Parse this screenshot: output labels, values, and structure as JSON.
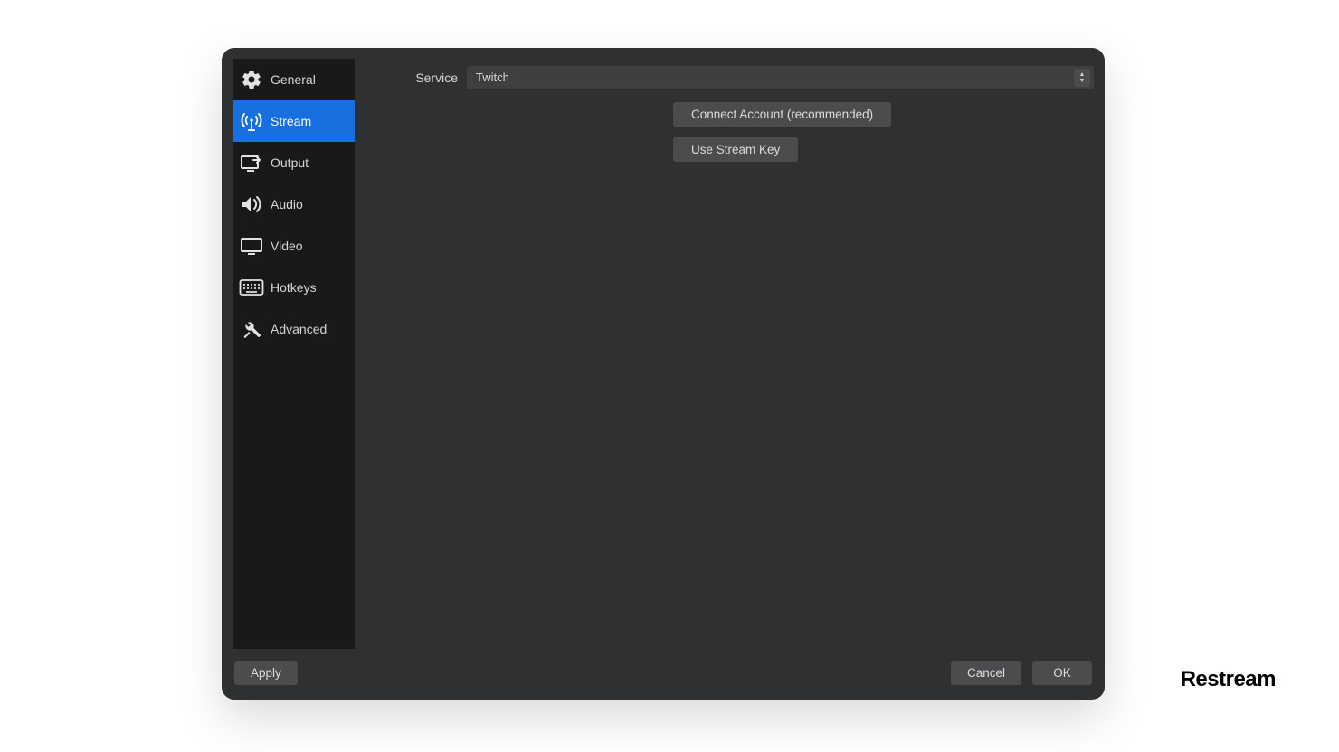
{
  "sidebar": {
    "items": [
      {
        "label": "General",
        "icon": "gear-icon"
      },
      {
        "label": "Stream",
        "icon": "broadcast-icon"
      },
      {
        "label": "Output",
        "icon": "output-icon"
      },
      {
        "label": "Audio",
        "icon": "speaker-icon"
      },
      {
        "label": "Video",
        "icon": "monitor-icon"
      },
      {
        "label": "Hotkeys",
        "icon": "keyboard-icon"
      },
      {
        "label": "Advanced",
        "icon": "tools-icon"
      }
    ],
    "selected_index": 1
  },
  "content": {
    "service_label": "Service",
    "service_value": "Twitch",
    "connect_button": "Connect Account (recommended)",
    "streamkey_button": "Use Stream Key"
  },
  "footer": {
    "apply": "Apply",
    "cancel": "Cancel",
    "ok": "OK"
  },
  "brand": "Restream"
}
